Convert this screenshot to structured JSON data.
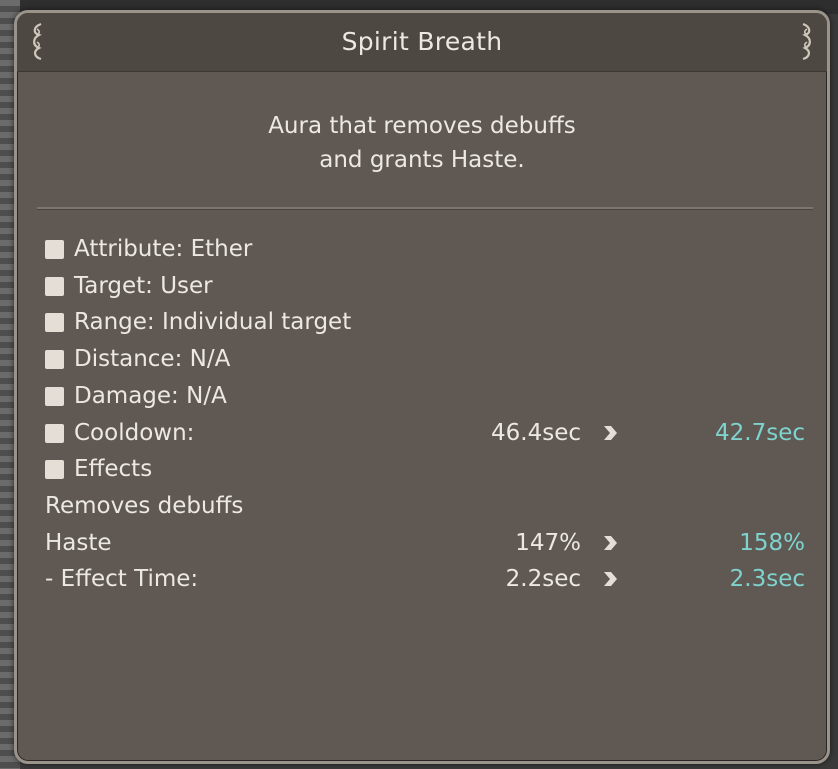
{
  "skill": {
    "title": "Spirit Breath",
    "description_lines": [
      "Aura that removes debuffs",
      "and grants Haste."
    ]
  },
  "stats": [
    {
      "label": "Attribute: Ether",
      "bullet": true
    },
    {
      "label": "Target: User",
      "bullet": true
    },
    {
      "label": "Range: Individual target",
      "bullet": true
    },
    {
      "label": "Distance: N/A",
      "bullet": true
    },
    {
      "label": "Damage: N/A",
      "bullet": true
    },
    {
      "label": "Cooldown:",
      "bullet": true,
      "old": "46.4sec",
      "new": "42.7sec"
    },
    {
      "label": "Effects",
      "bullet": true
    },
    {
      "label": "Removes debuffs",
      "bullet": false
    },
    {
      "label": "Haste",
      "bullet": false,
      "old": "147%",
      "new": "158%"
    },
    {
      "label": "- Effect Time:",
      "bullet": false,
      "old": "2.2sec",
      "new": "2.3sec"
    }
  ],
  "colors": {
    "panel_bg": "#605953",
    "header_bg": "#4e4843",
    "text": "#ece8e2",
    "upgrade_value": "#7fd3cf",
    "bullet": "#e4ded6"
  },
  "icons": {
    "bullet": "square-bullet-icon",
    "arrow": "chevron-right-icon",
    "ornament": "scroll-ornament-icon"
  }
}
